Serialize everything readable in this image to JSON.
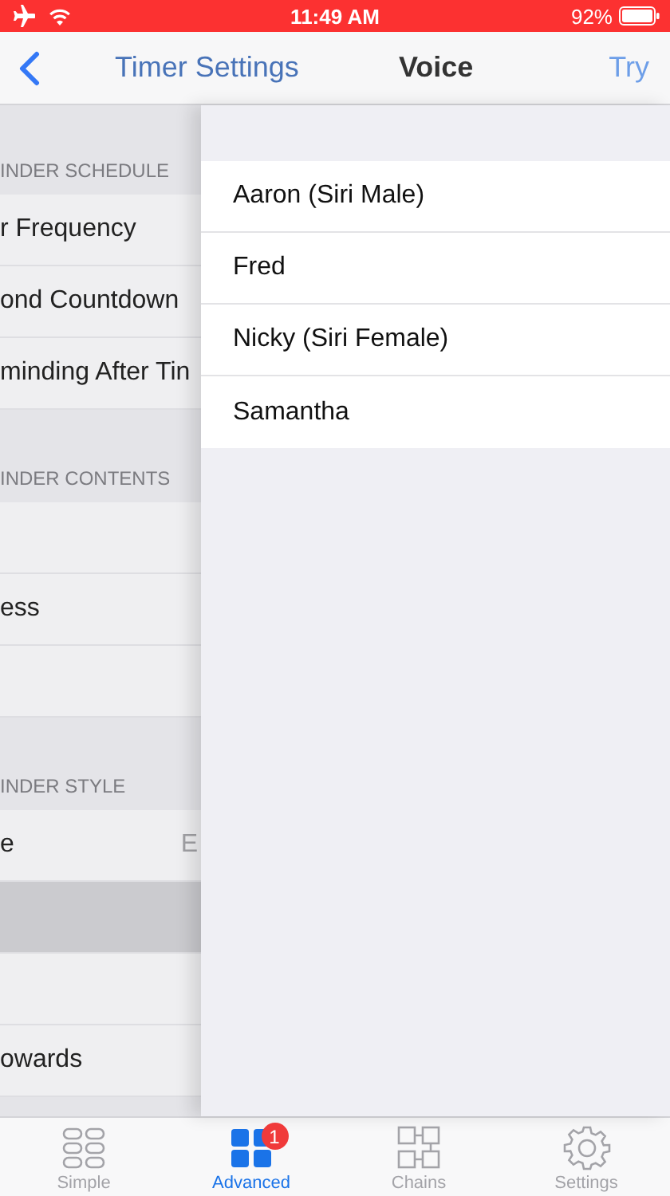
{
  "status_bar": {
    "time": "11:49 AM",
    "battery": "92%"
  },
  "nav": {
    "back_title": "Timer Settings",
    "title": "Voice",
    "action": "Try"
  },
  "background_list": [
    {
      "kind": "header",
      "text": "INDER SCHEDULE"
    },
    {
      "kind": "row",
      "label": "r Frequency",
      "selected": false
    },
    {
      "kind": "row",
      "label": "ond Countdown",
      "selected": false
    },
    {
      "kind": "row",
      "label": "minding After Tin",
      "selected": false
    },
    {
      "kind": "header",
      "text": "INDER CONTENTS"
    },
    {
      "kind": "row",
      "selected": false
    },
    {
      "kind": "row",
      "label": "ess",
      "selected": false
    },
    {
      "kind": "row",
      "selected": false
    },
    {
      "kind": "header",
      "text": "INDER STYLE"
    },
    {
      "kind": "row",
      "label": "e",
      "value": "E",
      "selected": false
    },
    {
      "kind": "row",
      "selected": true
    },
    {
      "kind": "row",
      "selected": false
    },
    {
      "kind": "row",
      "label": "owards",
      "selected": false
    },
    {
      "kind": "spacer"
    }
  ],
  "voices": [
    {
      "name": "Aaron (Siri Male)"
    },
    {
      "name": "Fred"
    },
    {
      "name": "Nicky (Siri Female)"
    },
    {
      "name": "Samantha"
    }
  ],
  "tabs": [
    {
      "label": "Simple",
      "selected": false
    },
    {
      "label": "Advanced",
      "selected": true,
      "badge": "1"
    },
    {
      "label": "Chains",
      "selected": false
    },
    {
      "label": "Settings",
      "selected": false
    }
  ]
}
